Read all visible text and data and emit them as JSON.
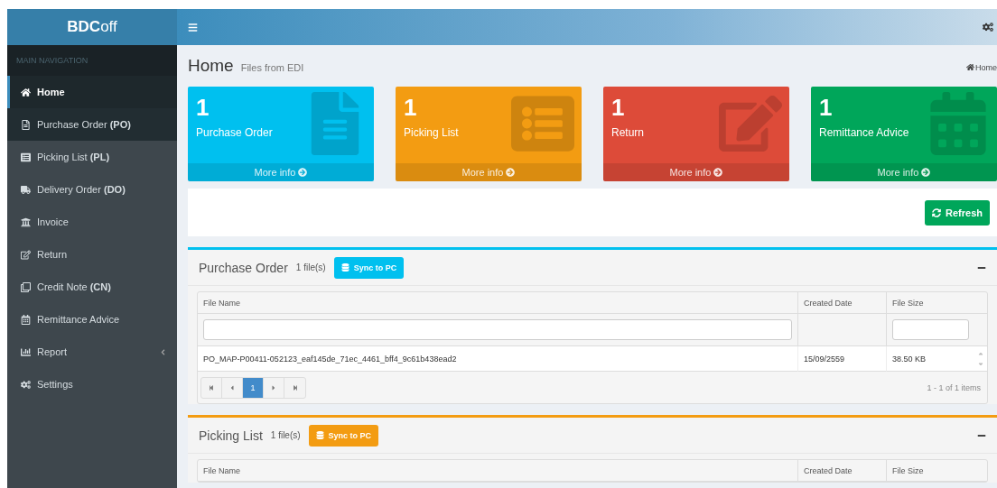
{
  "sidebar": {
    "brand": "**BDC**off",
    "section_label": "MAIN NAVIGATION",
    "items": [
      {
        "label": "**Home**",
        "selected": true,
        "highlighted": false,
        "expandable": false
      },
      {
        "label": "Purchase Order **(PO)**",
        "selected": false,
        "highlighted": true,
        "expandable": false
      },
      {
        "label": "Picking List **(PL)**",
        "selected": false,
        "highlighted": false,
        "expandable": false
      },
      {
        "label": "Delivery Order **(DO)**",
        "selected": false,
        "highlighted": false,
        "expandable": false
      },
      {
        "label": "Invoice",
        "selected": false,
        "highlighted": false,
        "expandable": false
      },
      {
        "label": "Return",
        "selected": false,
        "highlighted": false,
        "expandable": false
      },
      {
        "label": "Credit Note **(CN)**",
        "selected": false,
        "highlighted": false,
        "expandable": false
      },
      {
        "label": "Remittance Advice",
        "selected": false,
        "highlighted": false,
        "expandable": false
      },
      {
        "label": "Report",
        "selected": false,
        "highlighted": false,
        "expandable": true
      },
      {
        "label": "Settings",
        "selected": false,
        "highlighted": false,
        "expandable": false
      }
    ]
  },
  "page": {
    "title": "Home",
    "subtitle": "Files from EDI",
    "breadcrumb": "Home"
  },
  "stat_boxes": [
    {
      "count": "1",
      "label": "Purchase Order",
      "link": "More info",
      "color": "#00c0ef"
    },
    {
      "count": "1",
      "label": "Picking List",
      "link": "More info",
      "color": "#f39c12"
    },
    {
      "count": "1",
      "label": "Return",
      "link": "More info",
      "color": "#dd4b39"
    },
    {
      "count": "1",
      "label": "Remittance Advice",
      "link": "More info",
      "color": "#00a65a"
    }
  ],
  "refresh_button": "Refresh",
  "panels": [
    {
      "title": "Purchase Order",
      "count": "1 file(s)",
      "sync_button": "Sync to PC",
      "color": "#00c0ef",
      "columns": [
        "File Name",
        "Created Date",
        "File Size"
      ],
      "filters": [
        {
          "kind": "input"
        },
        {
          "kind": "none"
        },
        {
          "kind": "input"
        }
      ],
      "rows": [
        [
          "PO_MAP-P00411-052123_eaf145de_71ec_4461_bff4_9c61b438ead2",
          "15/09/2559",
          "38.50 KB"
        ]
      ],
      "pager": {
        "pages": [
          {
            "label": "1",
            "selected": true
          }
        ],
        "info": "1 - 1 of 1 items"
      }
    },
    {
      "title": "Picking List",
      "count": "1 file(s)",
      "sync_button": "Sync to PC",
      "color": "#f39c12",
      "columns": [
        "File Name",
        "Created Date",
        "File Size"
      ]
    }
  ]
}
